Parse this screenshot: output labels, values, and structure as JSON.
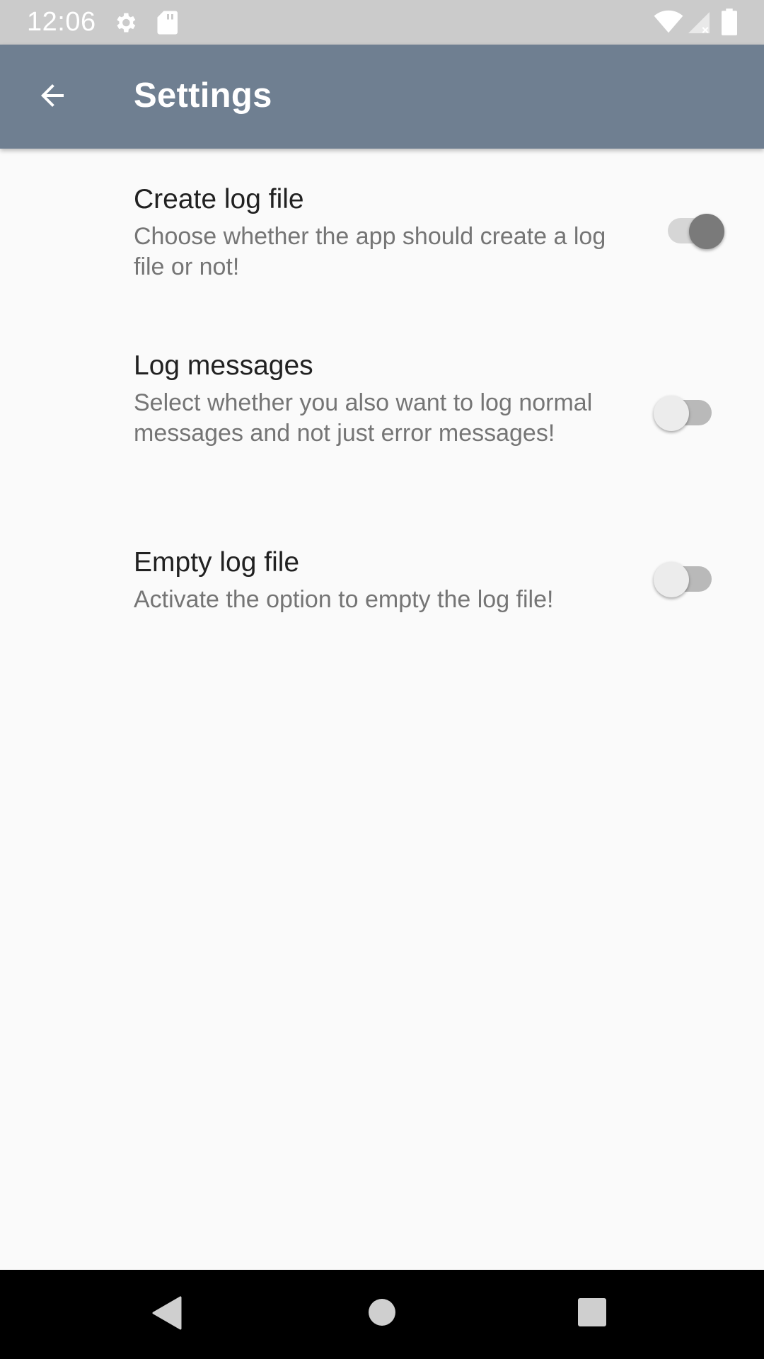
{
  "status_bar": {
    "time": "12:06",
    "icons": [
      "gear-icon",
      "sd-card-icon",
      "wifi-icon",
      "signal-icon",
      "battery-icon"
    ]
  },
  "app_bar": {
    "title": "Settings",
    "back_icon": "arrow-back-icon",
    "color": "#6f7f91"
  },
  "preferences": [
    {
      "title": "Create log file",
      "summary": "Choose whether the app should create a log file or not!",
      "enabled": true
    },
    {
      "title": "Log messages",
      "summary": "Select whether you also want to log normal messages and not just error messages!",
      "enabled": false
    },
    {
      "title": "Empty log file",
      "summary": "Activate the option to empty the log file!",
      "enabled": false
    }
  ],
  "switch_colors": {
    "on_thumb": "#7a7a7a",
    "on_track": "#d6d6d6",
    "off_thumb": "#ececec",
    "off_track": "#b9b9b9"
  },
  "nav_bar": {
    "buttons": [
      "back-triangle-icon",
      "home-circle-icon",
      "recents-square-icon"
    ]
  }
}
